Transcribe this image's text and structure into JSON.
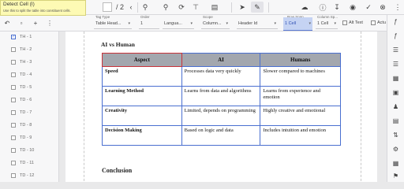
{
  "tooltip": {
    "title": "Detect Cell (I)",
    "description": "Use this to split the table into constituent cells."
  },
  "toolbar": {
    "page_total": "/ 2",
    "icons": [
      "chevron-left-icon",
      "zoom-out-icon",
      "zoom-in-icon",
      "rotate-icon",
      "split-icon",
      "cursor-icon",
      "pen-icon",
      "cloud-upload-icon",
      "help-icon",
      "download-icon",
      "eye-icon",
      "check-circle-icon",
      "close-circle-icon",
      "more-icon"
    ]
  },
  "properties": {
    "tag_type": {
      "label": "Tag Type",
      "value": "Table Head..."
    },
    "order": {
      "label": "Order",
      "value": "1"
    },
    "language": {
      "label": "",
      "value": "Langua..."
    },
    "scope": {
      "label": "Scope",
      "value": "Column..."
    },
    "header_id": {
      "label": "",
      "value": "Header Id"
    },
    "row_span": {
      "label": "Row Span",
      "value": "1 Cell"
    },
    "column_span": {
      "label": "Column Sp...",
      "value": "1 Cell"
    },
    "alt_text": {
      "label": "Alt Text"
    },
    "actual": {
      "label": "Actu"
    }
  },
  "left_panel": {
    "items": [
      {
        "label": "TH - 1",
        "checked": true
      },
      {
        "label": "TH - 2",
        "checked": false
      },
      {
        "label": "TH - 3",
        "checked": false
      },
      {
        "label": "TD - 4",
        "checked": false
      },
      {
        "label": "TD - 5",
        "checked": false
      },
      {
        "label": "TD - 6",
        "checked": false
      },
      {
        "label": "TD - 7",
        "checked": false
      },
      {
        "label": "TD - 8",
        "checked": false
      },
      {
        "label": "TD - 9",
        "checked": false
      },
      {
        "label": "TD - 10",
        "checked": false
      },
      {
        "label": "TD - 11",
        "checked": false
      },
      {
        "label": "TD - 12",
        "checked": false
      }
    ]
  },
  "document": {
    "title": "AI vs Human",
    "table": {
      "headers": [
        "Aspect",
        "AI",
        "Humans"
      ],
      "rows": [
        [
          "Speed",
          "Processes data very quickly",
          "Slower compared to machines"
        ],
        [
          "Learning Method",
          "Learns from data and algorithms",
          "Learns from experience and emotion"
        ],
        [
          "Creativity",
          "Limited, depends on programming",
          "Highly creative and emotional"
        ],
        [
          "Decision Making",
          "Based on logic and data",
          "Includes intuition and emotion"
        ]
      ]
    },
    "conclusion_heading": "Conclusion"
  },
  "colors": {
    "selection_red": "#c8323a",
    "cell_border_blue": "#4a6fd0",
    "header_fill": "#a3a7ae",
    "active_field": "#c5d3f3",
    "tooltip_bg": "#fdfab4"
  }
}
